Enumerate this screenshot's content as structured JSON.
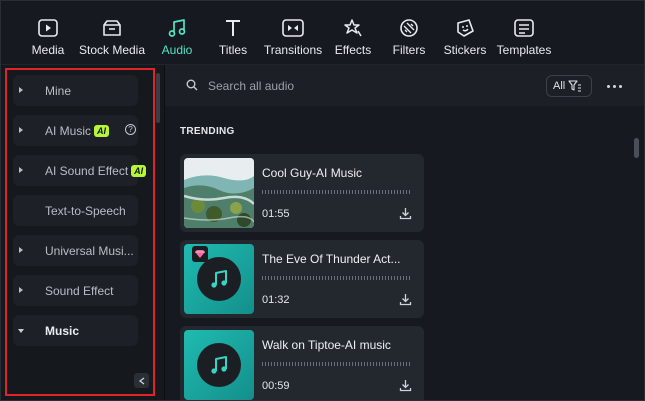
{
  "toolbar": {
    "tabs": [
      {
        "label": "Media",
        "icon": "media-icon"
      },
      {
        "label": "Stock Media",
        "icon": "stock-media-icon"
      },
      {
        "label": "Audio",
        "icon": "music-note-icon",
        "active": true
      },
      {
        "label": "Titles",
        "icon": "titles-icon"
      },
      {
        "label": "Transitions",
        "icon": "transitions-icon"
      },
      {
        "label": "Effects",
        "icon": "effects-icon"
      },
      {
        "label": "Filters",
        "icon": "filters-icon"
      },
      {
        "label": "Stickers",
        "icon": "stickers-icon"
      },
      {
        "label": "Templates",
        "icon": "templates-icon"
      }
    ],
    "active_color": "#52e3c2"
  },
  "sidebar": {
    "items": [
      {
        "label": "Mine"
      },
      {
        "label": "AI Music",
        "badge": "AI"
      },
      {
        "label": "AI Sound Effect",
        "badge": "AI"
      },
      {
        "label": "Text-to-Speech"
      },
      {
        "label": "Universal Musi..."
      },
      {
        "label": "Sound Effect"
      },
      {
        "label": "Music"
      }
    ],
    "highlight_color": "#e0242a"
  },
  "search": {
    "placeholder": "Search all audio",
    "filter_label": "All"
  },
  "main": {
    "section_title": "TRENDING",
    "tracks": [
      {
        "title": "Cool Guy-AI Music",
        "duration": "01:55"
      },
      {
        "title": "The Eve Of Thunder Act...",
        "duration": "01:32"
      },
      {
        "title": "Walk on Tiptoe-AI music",
        "duration": "00:59"
      }
    ]
  }
}
